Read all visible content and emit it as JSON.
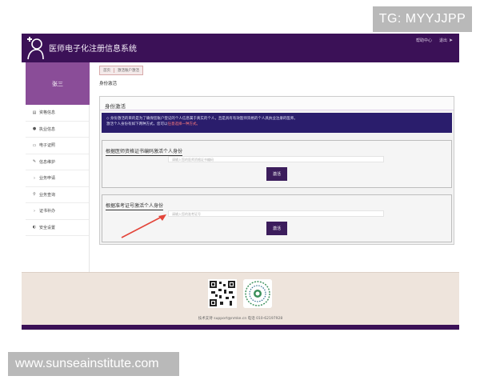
{
  "watermarks": {
    "top_right": "TG: MYYJJPP",
    "bottom_left": "www.sunseainstitute.com"
  },
  "header": {
    "title": "医师电子化注册信息系统",
    "links": [
      {
        "label": "帮助中心",
        "icon": "help-icon"
      },
      {
        "label": "退出",
        "icon": "logout-icon"
      }
    ]
  },
  "sidebar": {
    "user_name": "张三",
    "items": [
      {
        "label": "资格信息",
        "icon": "document-icon"
      },
      {
        "label": "执业信息",
        "icon": "users-icon"
      },
      {
        "label": "电子证照",
        "icon": "card-icon"
      },
      {
        "label": "信息维护",
        "icon": "edit-icon"
      },
      {
        "label": "业务申请",
        "icon": "chevron-right-icon"
      },
      {
        "label": "业务查询",
        "icon": "search-icon"
      },
      {
        "label": "证书补办",
        "icon": "chevron-right-icon"
      },
      {
        "label": "安全设置",
        "icon": "shield-icon"
      }
    ]
  },
  "breadcrumb": [
    "首页",
    "激活账户激活"
  ],
  "page_title": "身份激活",
  "panel": {
    "title": "身份激活",
    "notice_line1": "身份激活的目的是为了确保您账户登记的个人信息属于真实的个人，且是具有有效医师资格的个人具执业注册的医师。",
    "notice_line2_prefix": "激活个人身份有如下两种方式，您可以",
    "notice_line2_highlight": "任意选择一种方式。"
  },
  "sections": [
    {
      "title": "根据医师资格证书编码激活个人身份",
      "placeholder": "请输入您的医师资格证书编码",
      "button": "激活"
    },
    {
      "title": "根据准考证号激活个人身份",
      "placeholder": "请输入您的准考证号",
      "button": "激活"
    }
  ],
  "footer": {
    "text": "技术支持 support@nmke.cn  电话 010-62197928"
  },
  "colors": {
    "header": "#3b1157",
    "user_block": "#8a4d98",
    "notice": "#2a1d6c",
    "button": "#3c1d5c",
    "arrow": "#e3453a",
    "footer": "#eee4dc"
  }
}
